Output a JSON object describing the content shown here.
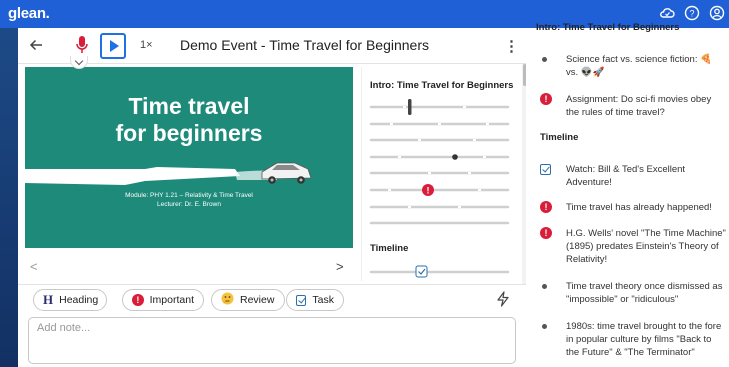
{
  "app": {
    "logo": "glean."
  },
  "toolbar": {
    "speed": "1×",
    "title": "Demo Event - Time Travel for Beginners"
  },
  "slide": {
    "title_line1": "Time travel",
    "title_line2": "for beginners",
    "module": "Module: PHY 1.21 – Relativity & Time Travel",
    "lecturer": "Lecturer: Dr. E. Brown"
  },
  "outline": {
    "heading": "Intro: Time Travel for Beginners",
    "timeline": "Timeline"
  },
  "nav": {
    "prev": "<",
    "next": ">"
  },
  "tags": {
    "heading": "Heading",
    "heading_icon": "H",
    "important": "Important",
    "review": "Review",
    "task": "Task"
  },
  "note": {
    "placeholder": "Add note..."
  },
  "side": {
    "cut_heading": "Intro: Time Travel for Beginners",
    "timeline_heading": "Timeline",
    "items": [
      {
        "type": "bullet",
        "text": "Science fact vs. science fiction: 🍕 vs. 👽🚀"
      },
      {
        "type": "important",
        "text": "Assignment: Do sci-fi movies obey the rules of time travel?"
      },
      {
        "type": "task",
        "text": "Watch: Bill & Ted's Excellent Adventure!"
      },
      {
        "type": "important",
        "text": "Time travel has already happened!"
      },
      {
        "type": "important",
        "text": "H.G. Wells' novel \"The Time Machine\" (1895) predates Einstein's Theory of Relativity!"
      },
      {
        "type": "bullet",
        "text": "Time travel theory once dismissed as \"impossible\" or \"ridiculous\""
      },
      {
        "type": "bullet",
        "text": "1980s: time travel brought to the fore in popular culture by films \"Back to the Future\" & \"The Terminator\""
      }
    ]
  },
  "colors": {
    "topbar": "#2060d6",
    "slide_bg": "#1e8a79",
    "accent": "#1f6fe5",
    "important": "#d91e3a",
    "mic": "#d91e3a"
  }
}
